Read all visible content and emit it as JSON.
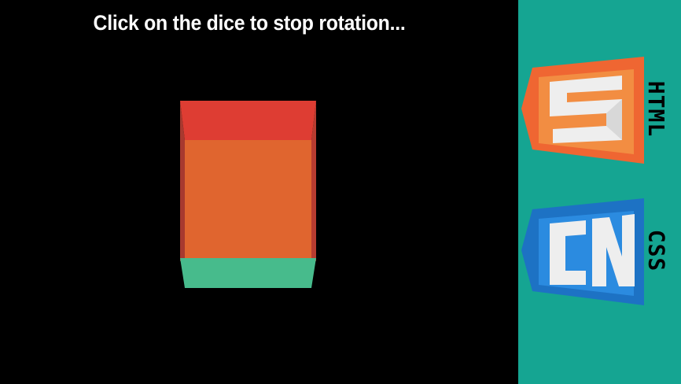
{
  "instruction": "Click on the dice to stop rotation...",
  "colors": {
    "background": "#000000",
    "sidebar": "#15a592",
    "dice_top": "#de3d33",
    "dice_front": "#e0652f",
    "dice_bottom": "#47bb8c",
    "html_badge": "#ef6632",
    "css_badge": "#1d72c4"
  },
  "sidebar": {
    "html_badge": {
      "label": "HTML",
      "icon": "html5-shield-icon"
    },
    "css_badge": {
      "label": "CSS",
      "icon": "css3-shield-icon"
    }
  }
}
